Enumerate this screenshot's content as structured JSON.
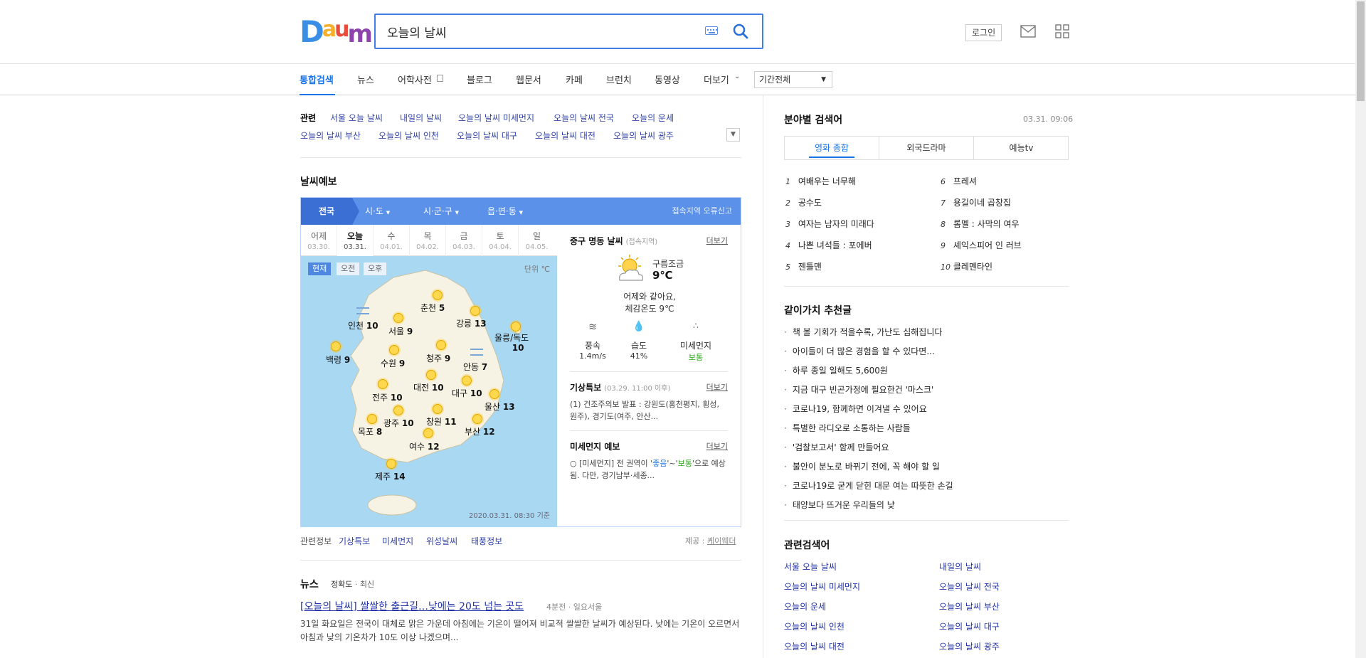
{
  "header": {
    "logo_letters": [
      "D",
      "a",
      "u",
      "m"
    ],
    "logo_colors": [
      "#3a8ee6",
      "#f4b02a",
      "#e74c3c",
      "#8e44ad"
    ],
    "search_value": "오늘의 날씨",
    "login_label": "로그인"
  },
  "tabs": [
    {
      "label": "통합검색",
      "active": true
    },
    {
      "label": "뉴스"
    },
    {
      "label": "어학사전"
    },
    {
      "label": "블로그"
    },
    {
      "label": "웹문서"
    },
    {
      "label": "카페"
    },
    {
      "label": "브런치"
    },
    {
      "label": "동영상"
    },
    {
      "label": "더보기"
    }
  ],
  "period_select": "기간전체",
  "related_top": {
    "label": "관련",
    "row1": [
      "서울 오늘 날씨",
      "내일의 날씨",
      "오늘의 날씨 미세먼지",
      "오늘의 날씨 전국",
      "오늘의 운세"
    ],
    "row2": [
      "오늘의 날씨 부산",
      "오늘의 날씨 인천",
      "오늘의 날씨 대구",
      "오늘의 날씨 대전",
      "오늘의 날씨 광주"
    ]
  },
  "forecast": {
    "title": "날씨예보",
    "regions": [
      "전국",
      "시·도",
      "시·군·구",
      "읍·면·동"
    ],
    "report_link": "접속지역 오류신고",
    "days": [
      {
        "d": "어제",
        "dt": "03.30."
      },
      {
        "d": "오늘",
        "dt": "03.31.",
        "today": true
      },
      {
        "d": "수",
        "dt": "04.01."
      },
      {
        "d": "목",
        "dt": "04.02."
      },
      {
        "d": "금",
        "dt": "04.03."
      },
      {
        "d": "토",
        "dt": "04.04."
      },
      {
        "d": "일",
        "dt": "04.05."
      }
    ],
    "time_buttons": [
      "현재",
      "오전",
      "오후"
    ],
    "unit": "단위 ℃",
    "map_time": "2020.03.31. 08:30 기준",
    "cities": [
      {
        "name": "춘천",
        "temp": "5"
      },
      {
        "name": "인천",
        "temp": "10"
      },
      {
        "name": "서울",
        "temp": "9"
      },
      {
        "name": "강릉",
        "temp": "13"
      },
      {
        "name": "울릉/독도",
        "temp": "10"
      },
      {
        "name": "백령",
        "temp": "9"
      },
      {
        "name": "수원",
        "temp": "9"
      },
      {
        "name": "청주",
        "temp": "9"
      },
      {
        "name": "안동",
        "temp": "7"
      },
      {
        "name": "대전",
        "temp": "10"
      },
      {
        "name": "대구",
        "temp": "10"
      },
      {
        "name": "전주",
        "temp": "10"
      },
      {
        "name": "울산",
        "temp": "13"
      },
      {
        "name": "광주",
        "temp": "10"
      },
      {
        "name": "창원",
        "temp": "11"
      },
      {
        "name": "목포",
        "temp": "8"
      },
      {
        "name": "부산",
        "temp": "12"
      },
      {
        "name": "여수",
        "temp": "12"
      },
      {
        "name": "제주",
        "temp": "14"
      }
    ],
    "current": {
      "location": "중구 명동 날씨",
      "location_note": "(접속지역)",
      "more": "더보기",
      "condition": "구름조금",
      "temp": "9℃",
      "compare": "어제와 같아요,",
      "feels": "체감온도 9℃",
      "stats": [
        {
          "label": "풍속",
          "value": "1.4m/s"
        },
        {
          "label": "습도",
          "value": "41%"
        },
        {
          "label": "미세먼지",
          "value": "보통"
        }
      ],
      "warning_title": "기상특보",
      "warning_note": "(03.29. 11:00 이후)",
      "warning_text": "(1) 건조주의보 발표 : 강원도(홍천평지, 횡성, 원주), 경기도(여주, 안산...",
      "dust_title": "미세먼지 예보",
      "dust_text_a": "○ [미세먼지] 전 권역이 '",
      "dust_good": "좋음",
      "dust_text_b": "'~'",
      "dust_normal": "보통",
      "dust_text_c": "'으로 예상됨. 다만, 경기남부·세종..."
    },
    "related_info_label": "관련정보",
    "related_info_links": [
      "기상특보",
      "미세먼지",
      "위성날씨",
      "태풍정보"
    ],
    "provider_label": "제공 :",
    "provider": "케이웨더"
  },
  "news": {
    "title": "뉴스",
    "sort_a": "정확도",
    "sort_b": "최신",
    "headline": "[오늘의 날씨] 쌀쌀한 출근길…낮에는 20도 넘는 곳도",
    "meta": "4분전 · 일요서울",
    "desc": "31일 화요일은 전국이 대체로 맑은 가운데 아침에는 기온이 떨어져 비교적 쌀쌀한 날씨가 예상된다. 낮에는 기온이 오르면서 아침과 낮의 기온차가 10도 이상 나겠으며..."
  },
  "right": {
    "rank_title": "분야별 검색어",
    "rank_time": "03.31. 09:06",
    "rank_tabs": [
      "영화 종합",
      "외국드라마",
      "예능tv"
    ],
    "ranks": [
      {
        "n": "1",
        "t": "여배우는 너무해"
      },
      {
        "n": "2",
        "t": "공수도"
      },
      {
        "n": "3",
        "t": "여자는 남자의 미래다"
      },
      {
        "n": "4",
        "t": "나쁜 녀석들 : 포에버"
      },
      {
        "n": "5",
        "t": "젠틀맨"
      },
      {
        "n": "6",
        "t": "프레셔"
      },
      {
        "n": "7",
        "t": "용길이네 곱창집"
      },
      {
        "n": "8",
        "t": "롬멜 : 사막의 여우"
      },
      {
        "n": "9",
        "t": "셰익스피어 인 러브"
      },
      {
        "n": "10",
        "t": "클레멘타인"
      }
    ],
    "rec_title": "같이가치 추천글",
    "rec_items": [
      "책 볼 기회가 적을수록, 가난도 심해집니다",
      "아이들이 더 많은 경험을 할 수 있다면...",
      "하루 종일 일해도 5,600원",
      "지금 대구 빈곤가정에 필요한건 '마스크'",
      "코로나19, 함께하면 이겨낼 수 있어요",
      "특별한 라디오로 소통하는 사람들",
      "'검찰보고서' 함께 만들어요",
      "불안이 분노로 바뀌기 전에, 꼭 해야 할 일",
      "코로나19로 굳게 닫힌 대문 여는 따뜻한 손길",
      "태양보다 뜨거운 우리들의 낮"
    ],
    "related_title": "관련검색어",
    "related": [
      "서울 오늘 날씨",
      "내일의 날씨",
      "오늘의 날씨 미세먼지",
      "오늘의 날씨 전국",
      "오늘의 운세",
      "오늘의 날씨 부산",
      "오늘의 날씨 인천",
      "오늘의 날씨 대구",
      "오늘의 날씨 대전",
      "오늘의 날씨 광주"
    ]
  }
}
